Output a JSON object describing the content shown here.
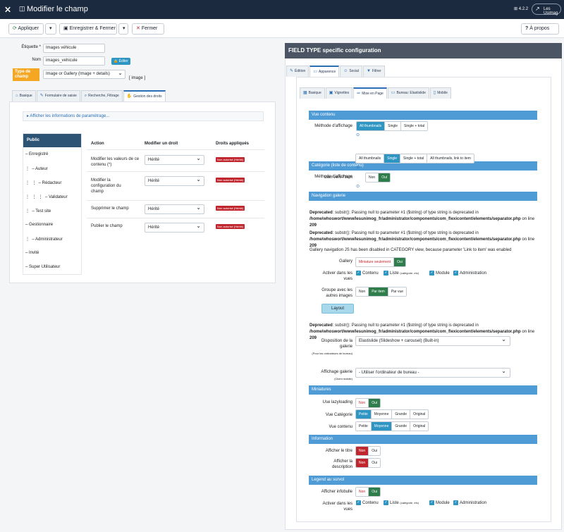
{
  "header": {
    "logo": "⨯",
    "page_icon": "◫",
    "title": "Modifier le champ",
    "version": "⊞ 4.2.2",
    "site_link": "Les Usimag"
  },
  "toolbar": {
    "apply": "Appliquer",
    "save_close": "Enregistrer & Fermer",
    "close": "Fermer",
    "help": "À propos"
  },
  "form": {
    "label_label": "Étiquette *",
    "label_value": "Images véhicule",
    "name_label": "Nom",
    "name_value": "images_vehicule",
    "toggle": "Éditer",
    "type_label": "Type de champ",
    "type_value": "Image or Gallery (Image + details)",
    "type_code": "[ image ]"
  },
  "left_tabs": [
    "Basique",
    "Formulaire de saisie",
    "Recherche, Filtrage",
    "Gestion des droits"
  ],
  "accordion": "Afficher les informations de paramétrage...",
  "perm": {
    "groups": [
      "Public",
      "Enregistré",
      "Auteur",
      "Rédacteur",
      "Validateur",
      "Test site",
      "Gestionnaire",
      "Administrateur",
      "Invité",
      "Super Utilisateur"
    ],
    "headers": [
      "Action",
      "Modifier un droit",
      "Droits appliqués"
    ],
    "rows": [
      {
        "action": "Modifier les valeurs de ce contenu (*)",
        "select": "Hérité",
        "status": "Non autorisé (Hérité)"
      },
      {
        "action": "Modifier la configuration du champ",
        "select": "Hérité",
        "status": "Non autorisé (Hérité)"
      },
      {
        "action": "Supprimer le champ",
        "select": "Hérité",
        "status": "Non autorisé (Hérité)"
      },
      {
        "action": "Publier le champ",
        "select": "Hérité",
        "status": "Non autorisé (Hérité)"
      }
    ]
  },
  "right": {
    "title": "FIELD TYPE specific configuration",
    "tabs": [
      "Édition",
      "Apparence",
      "Social",
      "Filtrer"
    ],
    "subtabs": [
      "Basique",
      "Vignettes",
      "Mise en Page",
      "Bureau: Elastislide",
      "Mobile"
    ],
    "vue_contenu": "Vue contenu",
    "methode": "Méthode d'affichage",
    "m1": [
      "All thumbnails",
      "Single",
      "Single + total"
    ],
    "categorie": "Catégorie (liste de contenu)",
    "m2": [
      "All thumbnails",
      "Single",
      "Single + total",
      "All thumbnails, link to item"
    ],
    "lien": "Lien vers l'item",
    "non": "Non",
    "oui": "Oui",
    "nav": "Navigation galerie",
    "dep_label": "Deprecated",
    "dep_text": ": substr(): Passing null to parameter #1 ($string) of type string is deprecated in ",
    "dep_path": "/home/whoswort/www/lesunimog_fr/administrator/components/com_flexicontent/elements/separator.php",
    "dep_line": " on line ",
    "dep_num": "209",
    "gallery_notice": "Gallery navigation JS has been disabled in CATEGORY view, because parameter 'Link to item' was enabled",
    "gallery": "Gallery",
    "gallery_opt": "Miniature seulement",
    "activer": "Activer dans les vues",
    "views": [
      "Contenu",
      "Liste",
      "Module",
      "Administration"
    ],
    "liste_note": "(catégorie, etc)",
    "groupe": "Groupe avec les autres images",
    "grp": [
      "Non",
      "Par item",
      "Par vue"
    ],
    "layout": "Layout",
    "disposition": "Disposition de la galerie",
    "disp_note": "(Pour les ordinateurs de bureau)",
    "disp_val": "Elastislide (Slideshow + carousel) (Built-in)",
    "affichage": "Affichage galerie",
    "aff_note": "(Client mobile)",
    "aff_val": "- Utiliser l'ordinateur de bureau -",
    "miniatures": "Miniatures",
    "lazy": "Use lazyloading",
    "vuecat": "Vue Catégorie",
    "vuecont": "Vue contenu",
    "sizes": [
      "Petite",
      "Moyenne",
      "Grande",
      "Original"
    ],
    "information": "Information",
    "titre": "Afficher le titre",
    "desc": "Afficher la description",
    "legend": "Legend au survol",
    "infobulle": "Afficher infobulle"
  }
}
